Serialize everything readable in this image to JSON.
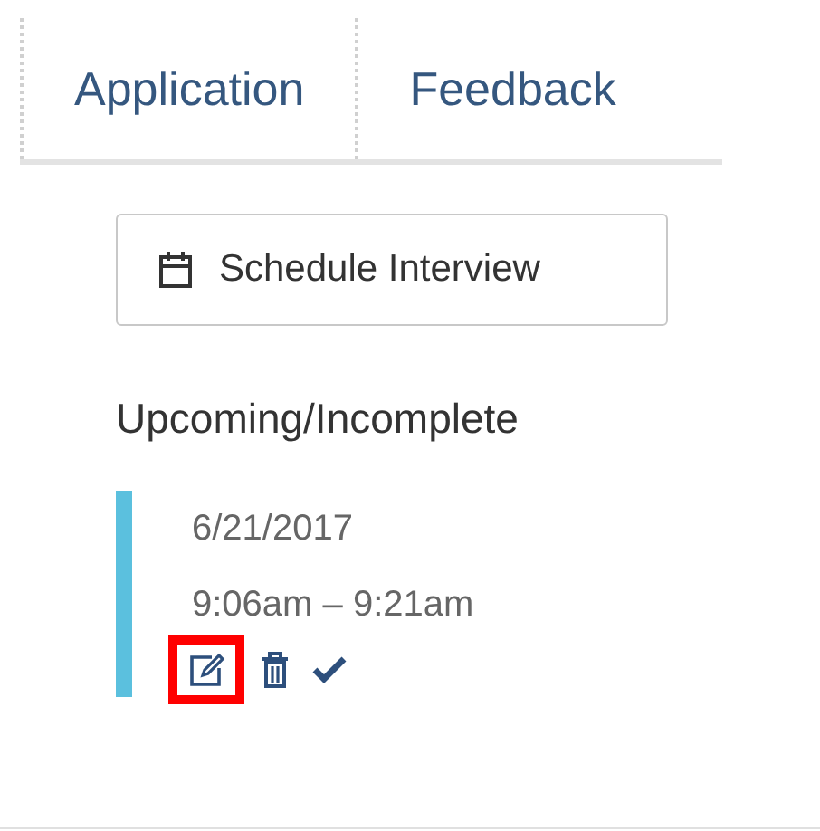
{
  "tabs": [
    {
      "label": "Application"
    },
    {
      "label": "Feedback"
    }
  ],
  "schedule_button": {
    "label": "Schedule Interview"
  },
  "section_title": "Upcoming/Incomplete",
  "interviews": [
    {
      "date": "6/21/2017",
      "time": "9:06am – 9:21am",
      "color": "#5bc0de",
      "actions": [
        {
          "kind": "edit",
          "highlighted": true
        },
        {
          "kind": "delete",
          "highlighted": false
        },
        {
          "kind": "complete",
          "highlighted": false
        }
      ]
    }
  ]
}
